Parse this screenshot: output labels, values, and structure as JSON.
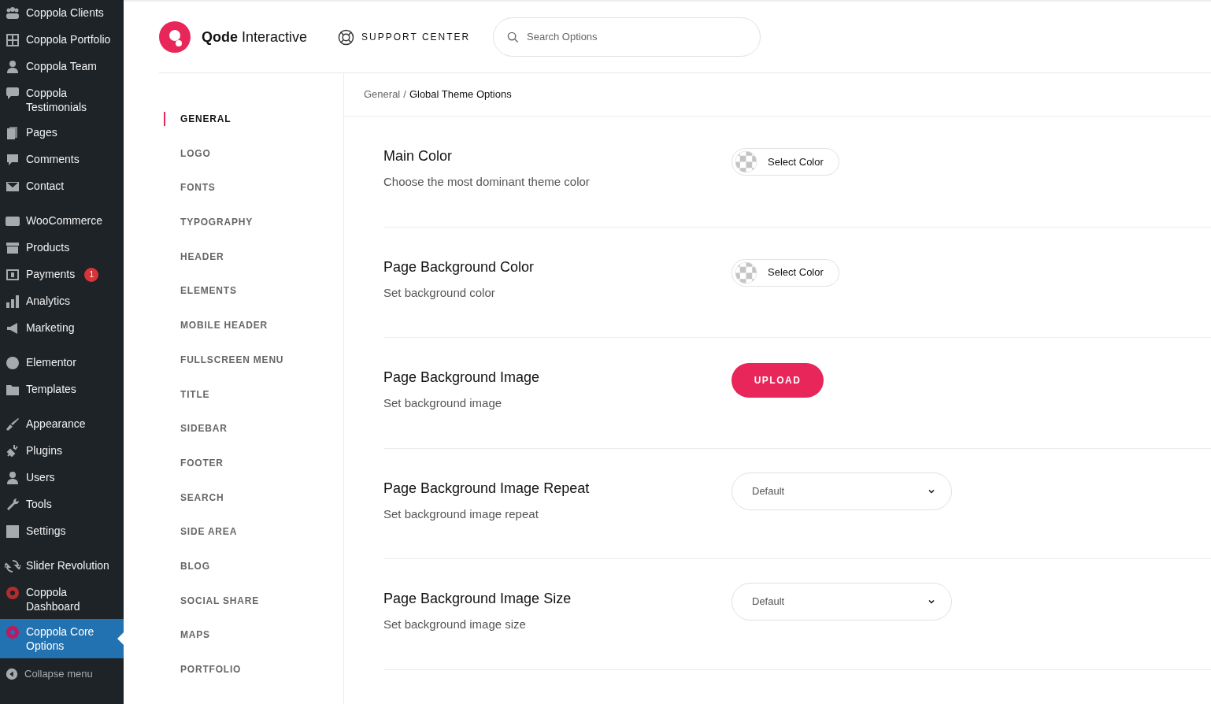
{
  "sidebar": {
    "groups": [
      [
        {
          "label": "Coppola Clients",
          "selected": false
        },
        {
          "label": "Coppola Portfolio",
          "selected": false
        },
        {
          "label": "Coppola Team",
          "selected": false
        },
        {
          "label": "Coppola Testimonials",
          "selected": false
        },
        {
          "label": "Pages",
          "selected": false
        },
        {
          "label": "Comments",
          "selected": false
        },
        {
          "label": "Contact",
          "selected": false
        }
      ],
      [
        {
          "label": "WooCommerce",
          "selected": false
        },
        {
          "label": "Products",
          "selected": false
        },
        {
          "label": "Payments",
          "selected": false,
          "badge": "1"
        },
        {
          "label": "Analytics",
          "selected": false
        },
        {
          "label": "Marketing",
          "selected": false
        }
      ],
      [
        {
          "label": "Elementor",
          "selected": false
        },
        {
          "label": "Templates",
          "selected": false
        }
      ],
      [
        {
          "label": "Appearance",
          "selected": false
        },
        {
          "label": "Plugins",
          "selected": false
        },
        {
          "label": "Users",
          "selected": false
        },
        {
          "label": "Tools",
          "selected": false
        },
        {
          "label": "Settings",
          "selected": false
        }
      ],
      [
        {
          "label": "Slider Revolution",
          "selected": false
        },
        {
          "label": "Coppola Dashboard",
          "selected": false
        },
        {
          "label": "Coppola Core Options",
          "selected": true
        }
      ]
    ],
    "collapse": "Collapse menu"
  },
  "header": {
    "brand_bold": "Qode",
    "brand_rest": "Interactive",
    "support": "SUPPORT CENTER",
    "search": {
      "placeholder": "Search Options"
    }
  },
  "nav": [
    {
      "label": "GENERAL",
      "selected": true
    },
    {
      "label": "LOGO",
      "selected": false
    },
    {
      "label": "FONTS",
      "selected": false
    },
    {
      "label": "TYPOGRAPHY",
      "selected": false
    },
    {
      "label": "HEADER",
      "selected": false
    },
    {
      "label": "ELEMENTS",
      "selected": false
    },
    {
      "label": "MOBILE HEADER",
      "selected": false
    },
    {
      "label": "FULLSCREEN MENU",
      "selected": false
    },
    {
      "label": "TITLE",
      "selected": false
    },
    {
      "label": "SIDEBAR",
      "selected": false
    },
    {
      "label": "FOOTER",
      "selected": false
    },
    {
      "label": "SEARCH",
      "selected": false
    },
    {
      "label": "SIDE AREA",
      "selected": false
    },
    {
      "label": "BLOG",
      "selected": false
    },
    {
      "label": "SOCIAL SHARE",
      "selected": false
    },
    {
      "label": "MAPS",
      "selected": false
    },
    {
      "label": "PORTFOLIO",
      "selected": false
    }
  ],
  "breadcrumb": {
    "parent": "General",
    "separator": "/",
    "current": "Global Theme Options"
  },
  "options": [
    {
      "title": "Main Color",
      "description": "Choose the most dominant theme color",
      "kind": "color",
      "control": "Select Color"
    },
    {
      "title": "Page Background Color",
      "description": "Set background color",
      "kind": "color",
      "control": "Select Color"
    },
    {
      "title": "Page Background Image",
      "description": "Set background image",
      "kind": "upload",
      "control": "UPLOAD"
    },
    {
      "title": "Page Background Image Repeat",
      "description": "Set background image repeat",
      "kind": "select",
      "control": "Default"
    },
    {
      "title": "Page Background Image Size",
      "description": "Set background image size",
      "kind": "select",
      "control": "Default"
    }
  ]
}
